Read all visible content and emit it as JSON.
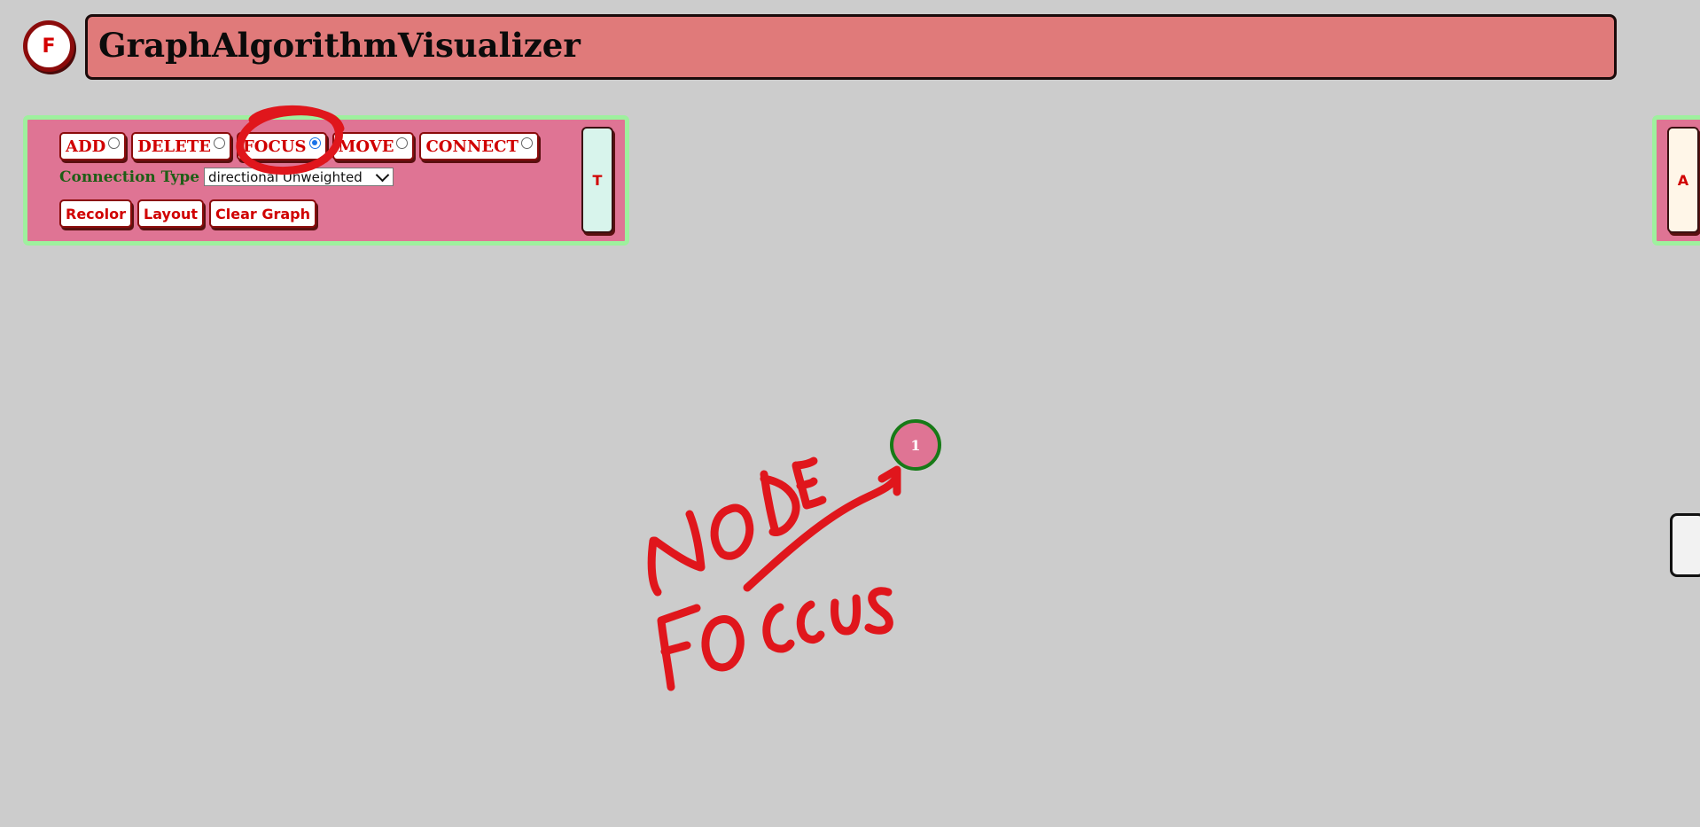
{
  "header": {
    "logo_letter": "F",
    "title": "GraphAlgorithmVisualizer"
  },
  "toolbar": {
    "modes": [
      {
        "label": "ADD",
        "selected": false
      },
      {
        "label": "DELETE",
        "selected": false
      },
      {
        "label": "FOCUS",
        "selected": true
      },
      {
        "label": "MOVE",
        "selected": false
      },
      {
        "label": "CONNECT",
        "selected": false
      }
    ],
    "connection_type_label": "Connection Type",
    "connection_type_value": "directional Unweighted",
    "actions": {
      "recolor": "Recolor",
      "layout": "Layout",
      "clear_graph": "Clear Graph"
    },
    "side_tab_label": "T"
  },
  "right_panel": {
    "tab_label": "A"
  },
  "graph": {
    "nodes": [
      {
        "label": "1"
      }
    ]
  },
  "annotation": {
    "line1": "NODE",
    "line2": "FOCUS",
    "color": "#e0161c"
  },
  "colors": {
    "background": "#cccccc",
    "title_bar": "#e07a7a",
    "panel": "#df7494",
    "panel_border": "#9ef09e",
    "button_text": "#d00000",
    "node_border": "#177a17"
  }
}
